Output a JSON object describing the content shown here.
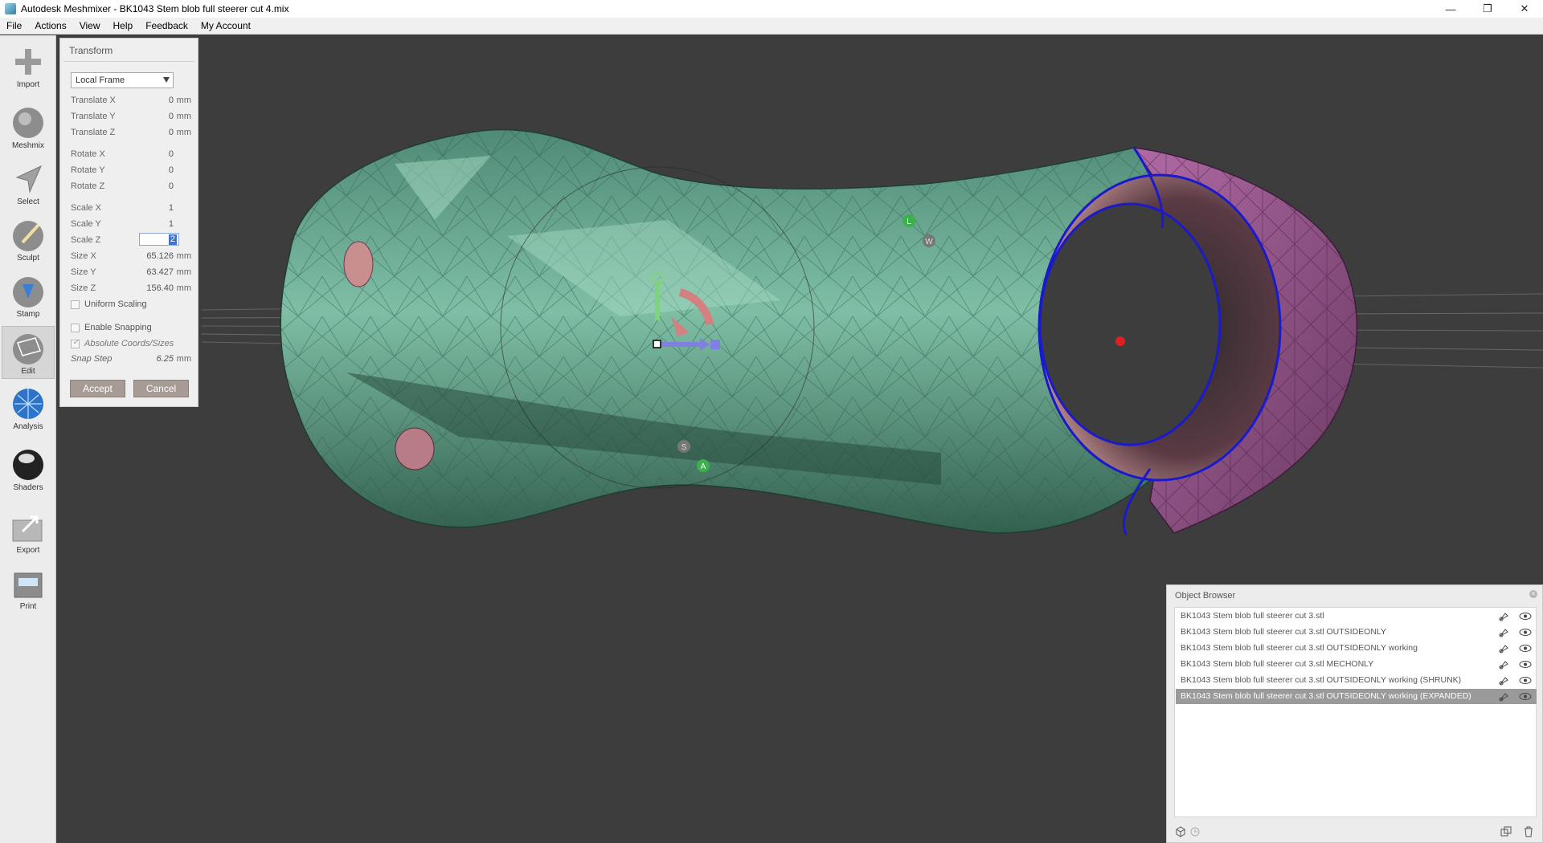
{
  "window": {
    "title": "Autodesk Meshmixer - BK1043 Stem blob full steerer cut 4.mix",
    "controls": [
      "—",
      "❐",
      "✕"
    ]
  },
  "menu": [
    "File",
    "Actions",
    "View",
    "Help",
    "Feedback",
    "My Account"
  ],
  "toolbar": [
    {
      "label": "Import",
      "icon": "plus-icon"
    },
    {
      "label": "Meshmix",
      "icon": "bunny-ball-icon"
    },
    {
      "label": "Select",
      "icon": "select-arrow-icon"
    },
    {
      "label": "Sculpt",
      "icon": "brush-ball-icon"
    },
    {
      "label": "Stamp",
      "icon": "stamp-ball-icon"
    },
    {
      "label": "Edit",
      "icon": "edit-ball-icon",
      "active": true
    },
    {
      "label": "Analysis",
      "icon": "analysis-sphere-icon"
    },
    {
      "label": "Shaders",
      "icon": "shader-ball-icon"
    },
    {
      "label": "Export",
      "icon": "export-icon"
    },
    {
      "label": "Print",
      "icon": "printer-icon"
    }
  ],
  "transform": {
    "title": "Transform",
    "frame": "Local Frame",
    "fields": [
      {
        "label": "Translate X",
        "value": "0",
        "unit": "mm"
      },
      {
        "label": "Translate Y",
        "value": "0",
        "unit": "mm"
      },
      {
        "label": "Translate Z",
        "value": "0",
        "unit": "mm"
      },
      {
        "label": "Rotate X",
        "value": "0",
        "unit": ""
      },
      {
        "label": "Rotate Y",
        "value": "0",
        "unit": ""
      },
      {
        "label": "Rotate Z",
        "value": "0",
        "unit": ""
      },
      {
        "label": "Scale X",
        "value": "1",
        "unit": ""
      },
      {
        "label": "Scale Y",
        "value": "1",
        "unit": ""
      },
      {
        "label": "Scale Z",
        "value": "2",
        "unit": "",
        "editing": true
      },
      {
        "label": "Size X",
        "value": "65.126",
        "unit": "mm"
      },
      {
        "label": "Size Y",
        "value": "63.427",
        "unit": "mm"
      },
      {
        "label": "Size Z",
        "value": "156.40",
        "unit": "mm"
      }
    ],
    "uniform_scaling": "Uniform Scaling",
    "enable_snapping": "Enable Snapping",
    "absolute_coords": "Absolute Coords/Sizes",
    "snap_step": {
      "label": "Snap Step",
      "value": "6.25",
      "unit": "mm"
    },
    "accept": "Accept",
    "cancel": "Cancel"
  },
  "gizmo_labels": [
    "L",
    "W",
    "S",
    "A"
  ],
  "object_browser": {
    "title": "Object Browser",
    "items": [
      "BK1043 Stem blob full steerer cut 3.stl",
      "BK1043 Stem blob full steerer cut 3.stl OUTSIDEONLY",
      "BK1043 Stem blob full steerer cut 3.stl OUTSIDEONLY working",
      "BK1043 Stem blob full steerer cut 3.stl MECHONLY",
      "BK1043 Stem blob full steerer cut 3.stl OUTSIDEONLY working (SHRUNK)",
      "BK1043 Stem blob full steerer cut 3.stl OUTSIDEONLY working (EXPANDED)"
    ],
    "selected_index": 5
  },
  "colors": {
    "viewport_bg": "#3d3d3d",
    "mesh_green": "#5e9c88",
    "mesh_purple": "#9a5b8e",
    "boundary_blue": "#1a1acc"
  }
}
